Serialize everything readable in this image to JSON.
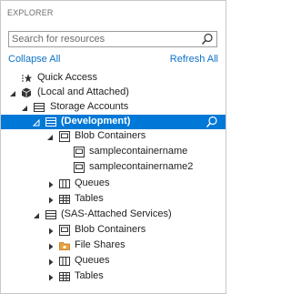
{
  "explorer": {
    "title": "EXPLORER",
    "search": {
      "placeholder": "Search for resources"
    },
    "actions": {
      "collapse_all": "Collapse All",
      "refresh_all": "Refresh All"
    }
  },
  "tree": {
    "quick_access": {
      "label": "Quick Access"
    },
    "local_attached": {
      "label": "(Local and Attached)"
    },
    "storage_accounts": {
      "label": "Storage Accounts"
    },
    "development": {
      "label": "(Development)"
    },
    "dev_blob_containers": {
      "label": "Blob Containers"
    },
    "container_1": {
      "label": "samplecontainername"
    },
    "container_2": {
      "label": "samplecontainername2"
    },
    "dev_queues": {
      "label": "Queues"
    },
    "dev_tables": {
      "label": "Tables"
    },
    "sas_attached": {
      "label": "(SAS-Attached Services)"
    },
    "sas_blob_containers": {
      "label": "Blob Containers"
    },
    "sas_file_shares": {
      "label": "File Shares"
    },
    "sas_queues": {
      "label": "Queues"
    },
    "sas_tables": {
      "label": "Tables"
    }
  },
  "colors": {
    "accent": "#0078d7",
    "link": "#0e72c7",
    "folder": "#e8a33d"
  }
}
